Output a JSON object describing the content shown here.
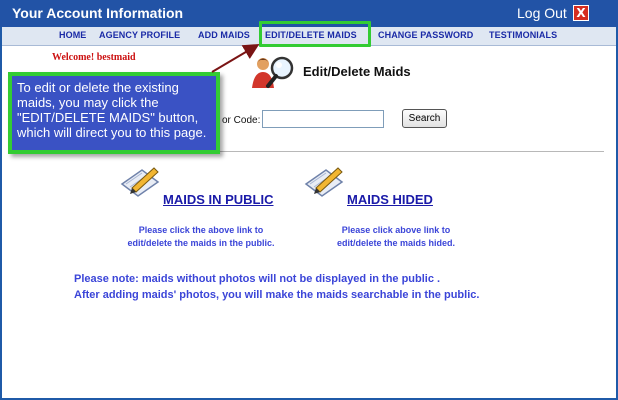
{
  "titlebar": {
    "title": "Your Account Information",
    "logout_label": "Log Out",
    "close_glyph": "X"
  },
  "nav": {
    "items": [
      {
        "label": "HOME"
      },
      {
        "label": "AGENCY PROFILE"
      },
      {
        "label": "ADD MAIDS"
      },
      {
        "label": "EDIT/DELETE MAIDS"
      },
      {
        "label": "CHANGE PASSWORD"
      },
      {
        "label": "TESTIMONIALS"
      }
    ],
    "highlighted": "EDIT/DELETE MAIDS"
  },
  "welcome": "Welcome! bestmaid",
  "page": {
    "heading": "Edit/Delete Maids",
    "header_icon": "user-search-icon"
  },
  "search": {
    "label": "or Code:",
    "value": "",
    "button_label": "Search"
  },
  "callout": {
    "text": "To edit or delete the existing maids, you may click the \"EDIT/DELETE MAIDS\" button, which will direct you to this page."
  },
  "links": {
    "public": {
      "title": "MAIDS IN PUBLIC",
      "desc_line1": "Please click the above link to",
      "desc_line2": "edit/delete the maids in the public.",
      "icon": "notepad-pencil-icon"
    },
    "hided": {
      "title": "MAIDS HIDED",
      "desc_line1": "Please click above link to",
      "desc_line2": "edit/delete the maids hided.",
      "icon": "notepad-pencil-icon"
    }
  },
  "note": {
    "line1": "Please note: maids without photos will not be displayed in the public .",
    "line2": "After adding maids' photos, you will make the maids searchable in the public."
  },
  "colors": {
    "titlebar": "#2253a6",
    "nav_text": "#1a2aa6",
    "highlight": "#33cc33",
    "welcome": "#cc1111",
    "callout_bg": "#3a52c4",
    "link": "#1a1aa8",
    "note_text": "#3b45d8"
  }
}
